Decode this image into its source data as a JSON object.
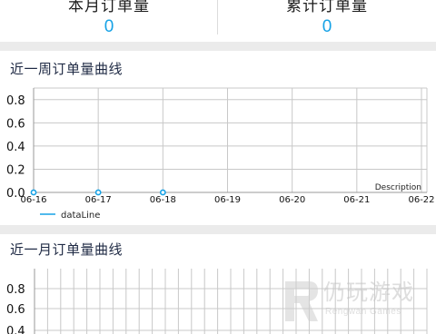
{
  "stats": {
    "monthly_label": "本月订单量",
    "monthly_value": "0",
    "total_label": "累计订单量",
    "total_value": "0"
  },
  "colors": {
    "accent": "#16a2e6",
    "grid": "#c8c8c8",
    "band": "#ebebeb"
  },
  "week_section": {
    "title": "近一周订单量曲线"
  },
  "month_section": {
    "title": "近一月订单量曲线"
  },
  "watermark": {
    "title": "仍玩游戏",
    "subtitle": "Rengwan Games"
  },
  "chart_data": [
    {
      "type": "line",
      "title": "",
      "xlabel": "",
      "ylabel": "",
      "x": [
        "06-16",
        "06-17",
        "06-18",
        "06-19",
        "06-20",
        "06-21",
        "06-22"
      ],
      "ylim": [
        0,
        0.9
      ],
      "y_ticks": [
        "0.8",
        "0.6",
        "0.4",
        "0.2",
        "0.0"
      ],
      "series": [
        {
          "name": "dataLine",
          "values": [
            0,
            0,
            0
          ],
          "color": "#16a2e6"
        }
      ],
      "description": "Description",
      "legend": "bottom-left",
      "grid": true
    },
    {
      "type": "line",
      "title": "",
      "xlabel": "",
      "ylabel": "",
      "ylim": [
        0,
        0.9
      ],
      "y_ticks": [
        "0.8",
        "0.6",
        "0.4"
      ],
      "series": [],
      "grid": true
    }
  ]
}
